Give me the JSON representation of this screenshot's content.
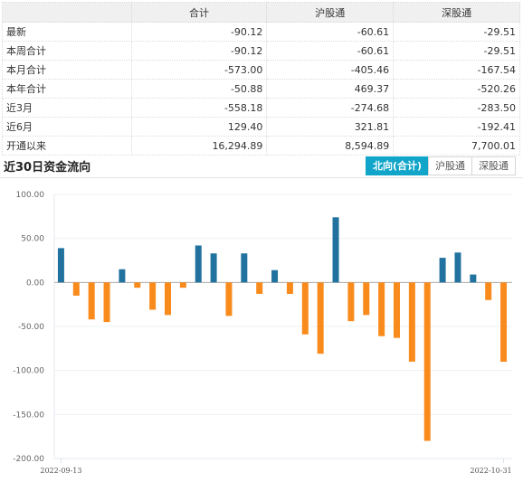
{
  "summary_table": {
    "headers": [
      "",
      "合计",
      "沪股通",
      "深股通"
    ],
    "rows": [
      {
        "label": "最新",
        "total": "-90.12",
        "sh": "-60.61",
        "sz": "-29.51"
      },
      {
        "label": "本周合计",
        "total": "-90.12",
        "sh": "-60.61",
        "sz": "-29.51"
      },
      {
        "label": "本月合计",
        "total": "-573.00",
        "sh": "-405.46",
        "sz": "-167.54"
      },
      {
        "label": "本年合计",
        "total": "-50.88",
        "sh": "469.37",
        "sz": "-520.26"
      },
      {
        "label": "近3月",
        "total": "-558.18",
        "sh": "-274.68",
        "sz": "-283.50"
      },
      {
        "label": "近6月",
        "total": "129.40",
        "sh": "321.81",
        "sz": "-192.41"
      },
      {
        "label": "开通以来",
        "total": "16,294.89",
        "sh": "8,594.89",
        "sz": "7,700.01"
      }
    ]
  },
  "section": {
    "title": "近30日资金流向",
    "tabs": [
      {
        "label": "北向(合计)",
        "active": true
      },
      {
        "label": "沪股通",
        "active": false
      },
      {
        "label": "深股通",
        "active": false
      }
    ]
  },
  "colors": {
    "positive": "#21729f",
    "negative": "#f98b1d",
    "accent": "#11a6c9"
  },
  "chart_data": {
    "type": "bar",
    "title": "近30日资金流向",
    "xlabel": "",
    "ylabel": "",
    "ylim": [
      -200,
      100
    ],
    "yticks": [
      100,
      50,
      0,
      -50,
      -100,
      -150,
      -200
    ],
    "ytick_labels": [
      "100.00",
      "50.00",
      "0.00",
      "-50.00",
      "-100.00",
      "-150.00",
      "-200.00"
    ],
    "x_tick_labels": [
      "2022-09-13",
      "2022-10-31"
    ],
    "grid": true,
    "series": [
      {
        "name": "北向(合计)",
        "values": [
          39,
          -15,
          -42,
          -45,
          15,
          -6,
          -31,
          -37,
          -6,
          42,
          33,
          -38,
          33,
          -13,
          14,
          -13,
          -59,
          -81,
          74,
          -44,
          -37,
          -61,
          -63,
          -90,
          -180,
          28,
          34,
          9,
          -20,
          -90.12
        ]
      }
    ]
  }
}
